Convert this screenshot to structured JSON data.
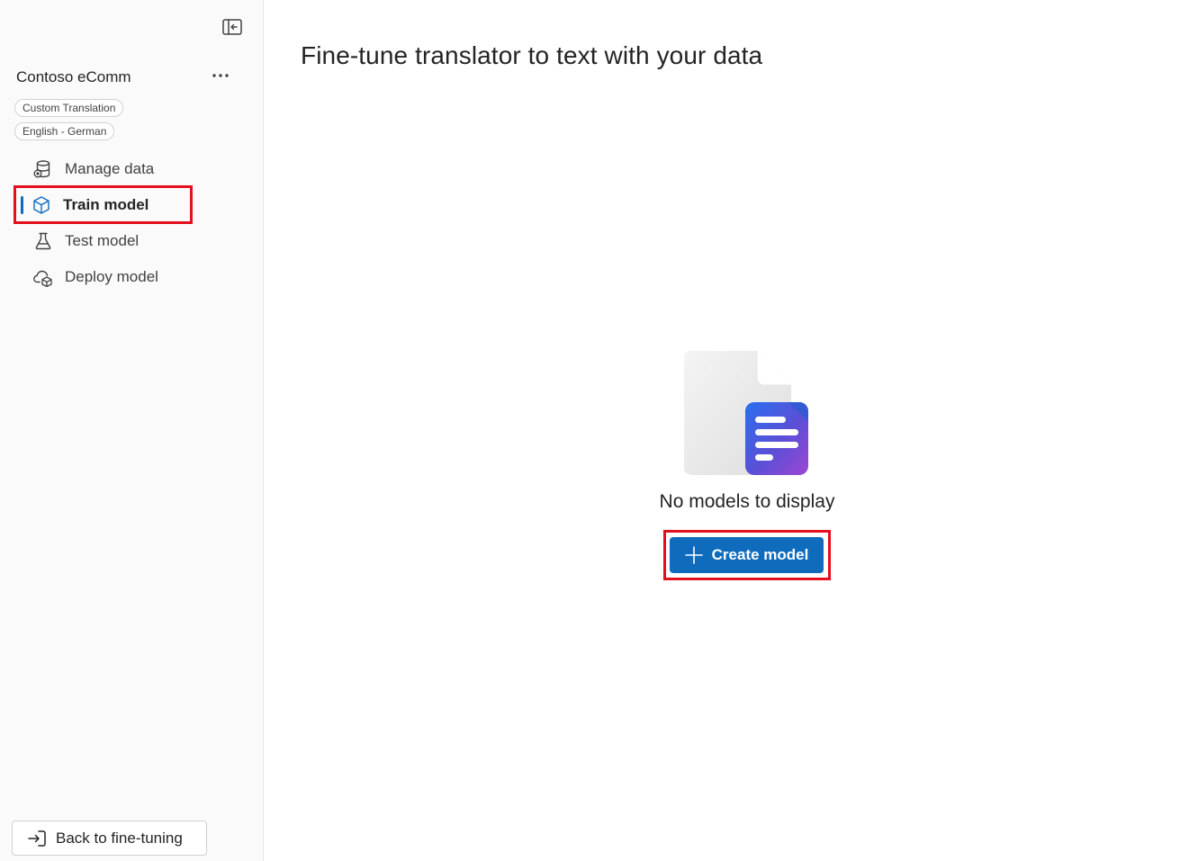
{
  "sidebar": {
    "project_title": "Contoso eComm",
    "badges": [
      "Custom Translation",
      "English - German"
    ],
    "items": [
      {
        "label": "Manage data",
        "icon": "database-icon"
      },
      {
        "label": "Train model",
        "icon": "cube-icon",
        "active": true
      },
      {
        "label": "Test model",
        "icon": "flask-icon"
      },
      {
        "label": "Deploy model",
        "icon": "cloud-icon"
      }
    ],
    "back_label": "Back to fine-tuning"
  },
  "main": {
    "title": "Fine-tune translator to text with your data",
    "empty_text": "No models to display",
    "create_label": "Create model"
  },
  "colors": {
    "accent": "#0f6cbd",
    "highlight": "#e3101e"
  }
}
